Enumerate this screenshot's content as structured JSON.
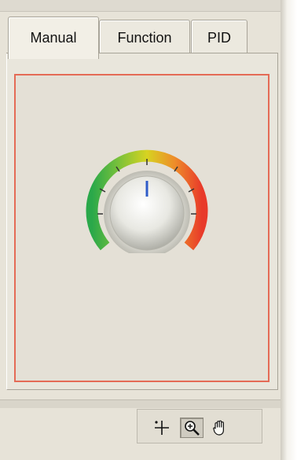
{
  "tabs": [
    {
      "label": "Manual",
      "active": true
    },
    {
      "label": "Function",
      "active": false
    },
    {
      "label": "PID",
      "active": false
    }
  ],
  "knob": {
    "level": 0.5,
    "scale_colors": [
      "#2aa84a",
      "#d7d321",
      "#e83a2a"
    ]
  },
  "toolbar": {
    "tools": [
      {
        "icon": "crosshair-icon",
        "pressed": false
      },
      {
        "icon": "zoom-icon",
        "pressed": true
      },
      {
        "icon": "pan-hand-icon",
        "pressed": false
      }
    ]
  },
  "colors": {
    "frame_border": "#e46b56",
    "indicator": "#2f5cc9"
  }
}
